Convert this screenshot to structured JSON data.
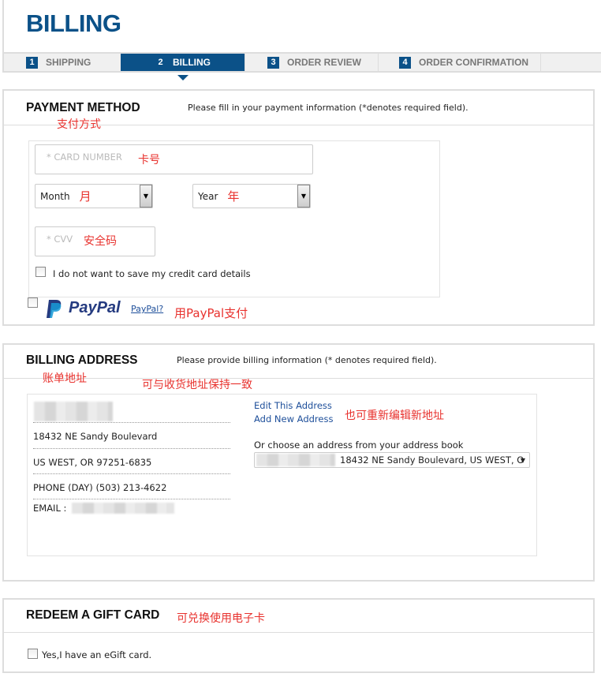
{
  "page_title": "BILLING",
  "steps": [
    {
      "num": "1",
      "label": "SHIPPING"
    },
    {
      "num": "2",
      "label": "BILLING",
      "active": true
    },
    {
      "num": "3",
      "label": "ORDER REVIEW"
    },
    {
      "num": "4",
      "label": "ORDER CONFIRMATION"
    }
  ],
  "payment": {
    "title": "PAYMENT METHOD",
    "note": "Please fill in your payment information (*denotes required field).",
    "card_placeholder": "* CARD NUMBER",
    "month": "Month",
    "year": "Year",
    "cvv_placeholder": "* CVV",
    "no_save_label": "I do not want to save my credit card details",
    "paypal_logo": "PayPal",
    "paypal_link": "PayPal?"
  },
  "billing": {
    "title": "BILLING ADDRESS",
    "note": "Please provide billing information (* denotes required field).",
    "street": "18432 NE Sandy Boulevard",
    "city": "US WEST, OR 97251-6835",
    "phone": "PHONE (DAY) (503) 213-4622",
    "email_label": "EMAIL :",
    "edit_link": "Edit This Address",
    "add_link": "Add New Address",
    "choose_label": "Or choose an address from your address book",
    "address_select": "18432 NE Sandy Boulevard, US WEST, O"
  },
  "gift": {
    "title": "REDEEM A GIFT CARD",
    "checkbox_label": "Yes,I have an eGift card."
  },
  "annotations": {
    "payment_method": "支付方式",
    "card_number": "卡号",
    "month": "月",
    "year": "年",
    "cvv": "安全码",
    "paypal": "用PayPal支付",
    "billing_address": "账单地址",
    "same_as_shipping": "可与收货地址保持一致",
    "edit_new": "也可重新编辑新地址",
    "gift": "可兑换使用电子卡"
  },
  "colors": {
    "brand": "#0b5188",
    "annotation": "#e8322e",
    "link": "#1e4f9a"
  }
}
